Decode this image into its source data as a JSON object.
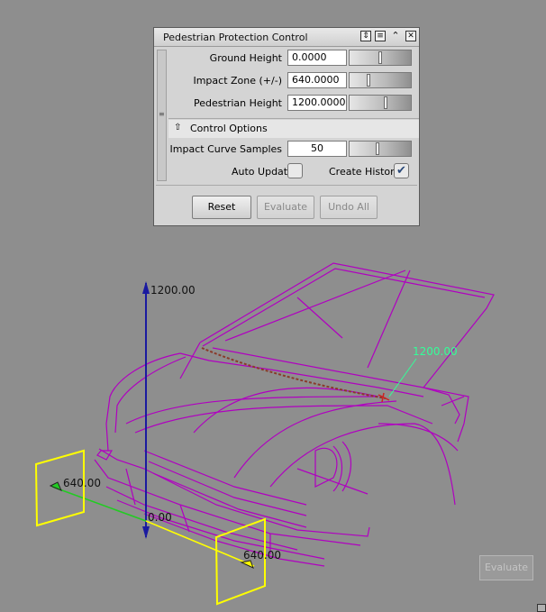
{
  "panel": {
    "title": "Pedestrian Protection Control",
    "fields": [
      {
        "label": "Ground Height",
        "value": "0.0000",
        "slider_level": 0.5
      },
      {
        "label": "Impact Zone (+/-)",
        "value": "640.0000",
        "slider_level": 0.3
      },
      {
        "label": "Pedestrian Height",
        "value": "1200.0000",
        "slider_level": 0.6
      }
    ],
    "section_label": "Control Options",
    "samples": {
      "label": "Impact Curve Samples",
      "value": "50",
      "slider_level": 0.45
    },
    "auto_update": {
      "label": "Auto Update",
      "checked": false
    },
    "create_history": {
      "label": "Create History",
      "checked": true
    },
    "buttons": {
      "reset": "Reset",
      "evaluate": "Evaluate",
      "undo_all": "Undo All"
    }
  },
  "viewport": {
    "height_label": "1200.00",
    "height_marker_label": "1200.00",
    "zone_left_label": "640.00",
    "zone_right_label": "640.00",
    "origin_label": "0.00",
    "evaluate_button": "Evaluate"
  },
  "colors": {
    "wireframe": "#b000c0",
    "zone_planes": "#ffff00",
    "height_axis": "#1a1aa0",
    "ground_axis": "#22cc22",
    "marker_text": "#33ff99",
    "impact_curve": "#8a3a2a"
  }
}
